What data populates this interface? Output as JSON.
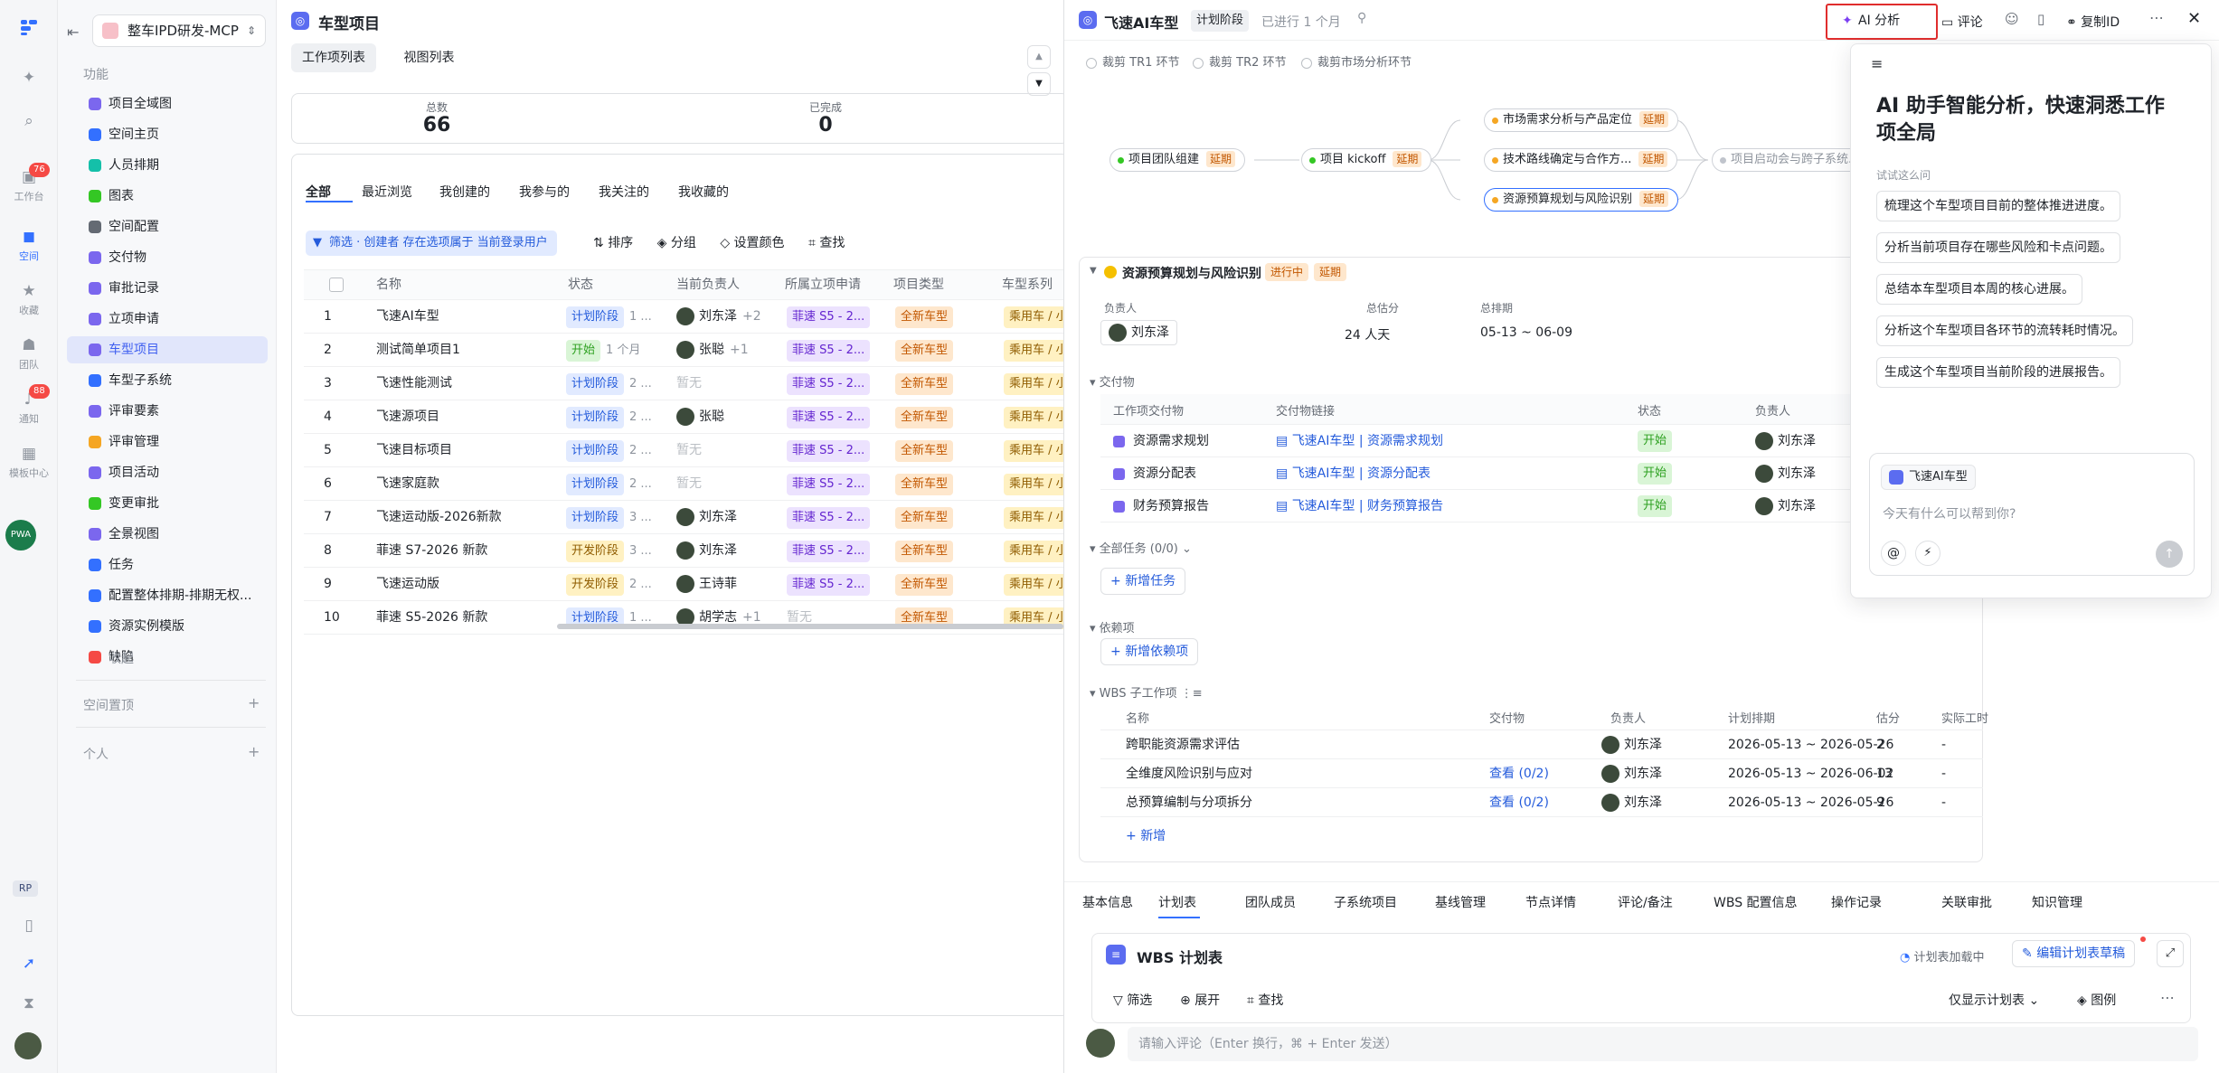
{
  "rail": {
    "items": [
      {
        "icon": "menu-grid-icon",
        "label": ""
      },
      {
        "icon": "sparkle-icon",
        "label": ""
      },
      {
        "icon": "search-icon",
        "label": ""
      },
      {
        "icon": "workbench-icon",
        "label": "工作台",
        "badge": "76"
      },
      {
        "icon": "space-icon",
        "label": "空间"
      },
      {
        "icon": "star-icon",
        "label": "收藏"
      },
      {
        "icon": "team-icon",
        "label": "团队"
      },
      {
        "icon": "bell-icon",
        "label": "通知",
        "badge": "88"
      },
      {
        "icon": "template-icon",
        "label": "模板中心"
      }
    ],
    "user_avatar": "PWA",
    "bottom": {
      "rp": "RP",
      "icons": [
        "phone-icon",
        "rocket-icon",
        "hourglass-icon"
      ]
    }
  },
  "nav": {
    "workspace": "整车IPD研发-MCP",
    "section_function": "功能",
    "items": [
      {
        "label": "项目全域图",
        "color": "#7b67ee"
      },
      {
        "label": "空间主页",
        "color": "#3370ff"
      },
      {
        "label": "人员排期",
        "color": "#14c0a9"
      },
      {
        "label": "图表",
        "color": "#34c724"
      },
      {
        "label": "空间配置",
        "color": "#646a73"
      },
      {
        "label": "交付物",
        "color": "#7b67ee"
      },
      {
        "label": "审批记录",
        "color": "#7b67ee"
      },
      {
        "label": "立项申请",
        "color": "#7b67ee"
      },
      {
        "label": "车型项目",
        "color": "#7b67ee",
        "active": true
      },
      {
        "label": "车型子系统",
        "color": "#3370ff"
      },
      {
        "label": "评审要素",
        "color": "#7b67ee"
      },
      {
        "label": "评审管理",
        "color": "#f5a623"
      },
      {
        "label": "项目活动",
        "color": "#7b67ee"
      },
      {
        "label": "变更审批",
        "color": "#34c724"
      },
      {
        "label": "全景视图",
        "color": "#7b67ee"
      },
      {
        "label": "任务",
        "color": "#3370ff"
      },
      {
        "label": "配置整体排期-排期无权...",
        "color": "#3370ff"
      },
      {
        "label": "资源实例模版",
        "color": "#3370ff"
      },
      {
        "label": "缺陷",
        "color": "#f54a45"
      }
    ],
    "collapse": "收起",
    "section_pinned": "空间置顶",
    "section_personal": "个人"
  },
  "main": {
    "title": "车型项目",
    "view_tabs": [
      "工作项列表",
      "视图列表"
    ],
    "stats": [
      {
        "label": "总数",
        "value": "66"
      },
      {
        "label": "已完成",
        "value": "0"
      }
    ],
    "filter_tabs": [
      "全部",
      "最近浏览",
      "我创建的",
      "我参与的",
      "我关注的",
      "我收藏的"
    ],
    "filter_chip": "筛选 · 创建者 存在选项属于 当前登录用户",
    "toolbar": [
      "排序",
      "分组",
      "设置颜色",
      "查找"
    ],
    "columns": [
      "名称",
      "状态",
      "当前负责人",
      "所属立项申请",
      "项目类型",
      "车型系列"
    ],
    "rows": [
      {
        "n": "1",
        "name": "飞速AI车型",
        "status": "计划阶段",
        "status_color": "blue",
        "dur": "1 ...",
        "owner": "刘东泽",
        "extra": "+2",
        "apply": "菲速 S5 - 2...",
        "type": "全新车型",
        "series": "乘用车 / 小"
      },
      {
        "n": "2",
        "name": "测试简单项目1",
        "status": "开始",
        "status_color": "green",
        "dur": "1 个月",
        "owner": "张聪",
        "extra": "+1",
        "apply": "菲速 S5 - 2...",
        "type": "全新车型",
        "series": "乘用车 / 小"
      },
      {
        "n": "3",
        "name": "飞速性能测试",
        "status": "计划阶段",
        "status_color": "blue",
        "dur": "2 ...",
        "owner": "暂无",
        "extra": "",
        "apply": "菲速 S5 - 2...",
        "type": "全新车型",
        "series": "乘用车 / 小"
      },
      {
        "n": "4",
        "name": "飞速源项目",
        "status": "计划阶段",
        "status_color": "blue",
        "dur": "2 ...",
        "owner": "张聪",
        "extra": "",
        "apply": "菲速 S5 - 2...",
        "type": "全新车型",
        "series": "乘用车 / 小"
      },
      {
        "n": "5",
        "name": "飞速目标项目",
        "status": "计划阶段",
        "status_color": "blue",
        "dur": "2 ...",
        "owner": "暂无",
        "extra": "",
        "apply": "菲速 S5 - 2...",
        "type": "全新车型",
        "series": "乘用车 / 小"
      },
      {
        "n": "6",
        "name": "飞速家庭款",
        "status": "计划阶段",
        "status_color": "blue",
        "dur": "2 ...",
        "owner": "暂无",
        "extra": "",
        "apply": "菲速 S5 - 2...",
        "type": "全新车型",
        "series": "乘用车 / 小"
      },
      {
        "n": "7",
        "name": "飞速运动版-2026新款",
        "status": "计划阶段",
        "status_color": "blue",
        "dur": "3 ...",
        "owner": "刘东泽",
        "extra": "",
        "apply": "菲速 S5 - 2...",
        "type": "全新车型",
        "series": "乘用车 / 小"
      },
      {
        "n": "8",
        "name": "菲速 S7-2026 新款",
        "status": "开发阶段",
        "status_color": "yellow",
        "dur": "3 ...",
        "owner": "刘东泽",
        "extra": "",
        "apply": "菲速 S5 - 2...",
        "type": "全新车型",
        "series": "乘用车 / 小"
      },
      {
        "n": "9",
        "name": "飞速运动版",
        "status": "开发阶段",
        "status_color": "yellow",
        "dur": "2 ...",
        "owner": "王诗菲",
        "extra": "",
        "apply": "菲速 S5 - 2...",
        "type": "全新车型",
        "series": "乘用车 / 小"
      },
      {
        "n": "10",
        "name": "菲速 S5-2026 新款",
        "status": "计划阶段",
        "status_color": "blue",
        "dur": "1 ...",
        "owner": "胡学志",
        "extra": "+1",
        "apply": "暂无",
        "type": "全新车型",
        "series": "乘用车 / 小"
      }
    ]
  },
  "panel": {
    "title": "飞速AI车型",
    "stage": "计划阶段",
    "elapsed": "已进行 1 个月",
    "actions": {
      "ai": "AI 分析",
      "comment": "评论",
      "copy_id": "复制ID"
    },
    "checkpoints": [
      "裁剪 TR1 环节",
      "裁剪 TR2 环节",
      "裁剪市场分析环节"
    ],
    "flow": [
      {
        "label": "项目团队组建",
        "delay": "延期",
        "dot": "#34c724"
      },
      {
        "label": "项目 kickoff",
        "delay": "延期",
        "dot": "#34c724"
      },
      {
        "label": "市场需求分析与产品定位",
        "delay": "延期",
        "dot": "#f5a623"
      },
      {
        "label": "技术路线确定与合作方...",
        "delay": "延期",
        "dot": "#f5a623"
      },
      {
        "label": "资源预算规划与风险识别",
        "delay": "延期",
        "dot": "#f5a623"
      },
      {
        "label": "项目启动会与跨子系统...",
        "delay": "",
        "dot": "#c0c4cc"
      }
    ],
    "node": {
      "title": "资源预算规划与风险识别",
      "status": "进行中",
      "delay": "延期",
      "owner_label": "负责人",
      "owner": "刘东泽",
      "estimate_label": "总估分",
      "estimate": "24 人天",
      "schedule_label": "总排期",
      "schedule": "05-13 ~ 06-09"
    },
    "deliverables": {
      "title": "交付物",
      "headers": [
        "工作项交付物",
        "交付物链接",
        "状态",
        "负责人"
      ],
      "rows": [
        {
          "name": "资源需求规划",
          "link": "飞速AI车型 | 资源需求规划",
          "status": "开始",
          "owner": "刘东泽"
        },
        {
          "name": "资源分配表",
          "link": "飞速AI车型 | 资源分配表",
          "status": "开始",
          "owner": "刘东泽"
        },
        {
          "name": "财务预算报告",
          "link": "飞速AI车型 | 财务预算报告",
          "status": "开始",
          "owner": "刘东泽"
        }
      ]
    },
    "all_tasks": "全部任务 (0/0)",
    "add_task": "新增任务",
    "deps": "依赖项",
    "add_dep": "新增依赖项",
    "wbs": {
      "title": "WBS 子工作项",
      "headers": [
        "名称",
        "交付物",
        "负责人",
        "计划排期",
        "估分",
        "实际工时"
      ],
      "rows": [
        {
          "name": "跨职能资源需求评估",
          "deliv": "",
          "owner": "刘东泽",
          "plan": "2026-05-13 ~ 2026-05-26",
          "est": "2",
          "actual": "-"
        },
        {
          "name": "全维度风险识别与应对",
          "deliv": "查看 (0/2)",
          "owner": "刘东泽",
          "plan": "2026-05-13 ~ 2026-06-02",
          "est": "13",
          "actual": "-"
        },
        {
          "name": "总预算编制与分项拆分",
          "deliv": "查看 (0/2)",
          "owner": "刘东泽",
          "plan": "2026-05-13 ~ 2026-05-26",
          "est": "9",
          "actual": "-"
        }
      ],
      "add": "新增"
    },
    "bottom_tabs": [
      "基本信息",
      "计划表",
      "团队成员",
      "子系统项目",
      "基线管理",
      "节点详情",
      "评论/备注",
      "WBS 配置信息",
      "操作记录",
      "关联审批",
      "知识管理"
    ],
    "plan": {
      "title": "WBS 计划表",
      "loading": "计划表加载中",
      "edit": "编辑计划表草稿",
      "tools": [
        "筛选",
        "展开",
        "查找"
      ],
      "only": "仅显示计划表",
      "legend": "图例"
    },
    "comment_placeholder": "请输入评论（Enter 换行，⌘ + Enter 发送）"
  },
  "ai": {
    "heading": "AI 助手智能分析，快速洞悉工作项全局",
    "try_label": "试试这么问",
    "suggestions": [
      "梳理这个车型项目目前的整体推进进度。",
      "分析当前项目存在哪些风险和卡点问题。",
      "总结本车型项目本周的核心进展。",
      "分析这个车型项目各环节的流转耗时情况。",
      "生成这个车型项目当前阶段的进展报告。"
    ],
    "context_chip": "飞速AI车型",
    "input_placeholder": "今天有什么可以帮到你?"
  }
}
